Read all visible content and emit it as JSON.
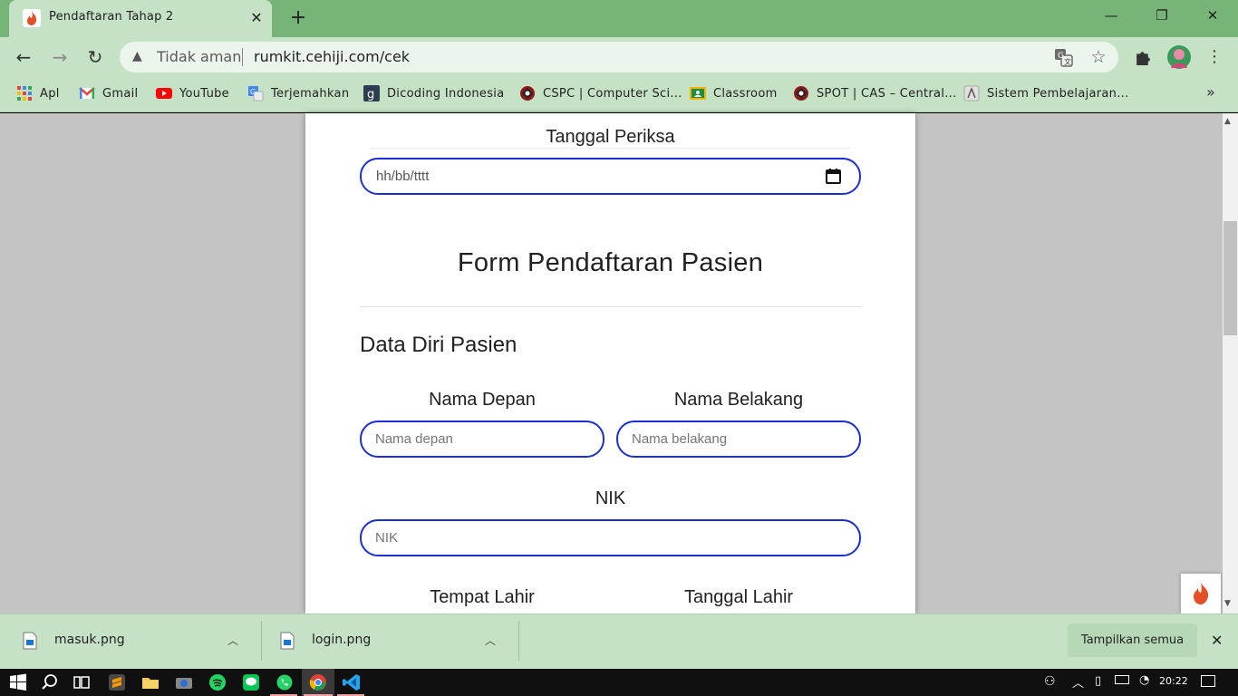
{
  "browser": {
    "tab": {
      "title": "Pendaftaran Tahap 2"
    },
    "omnibox": {
      "security_text": "Tidak aman",
      "url": "rumkit.cehiji.com/cek"
    },
    "bookmarks": [
      {
        "label": "Apl",
        "icon": "apps-grid-icon"
      },
      {
        "label": "Gmail",
        "icon": "gmail-icon"
      },
      {
        "label": "YouTube",
        "icon": "youtube-icon"
      },
      {
        "label": "Terjemahkan",
        "icon": "translate-icon"
      },
      {
        "label": "Dicoding Indonesia",
        "icon": "dicoding-icon"
      },
      {
        "label": "CSPC | Computer Sci...",
        "icon": "cspc-icon"
      },
      {
        "label": "Classroom",
        "icon": "classroom-icon"
      },
      {
        "label": "SPOT | CAS – Central...",
        "icon": "spot-icon"
      },
      {
        "label": "Sistem Pembelajaran...",
        "icon": "sistem-icon"
      }
    ],
    "bookmarks_overflow": "»"
  },
  "form": {
    "tanggal_periksa": {
      "label": "Tanggal Periksa",
      "placeholder": "hh/bb/tttt"
    },
    "title": "Form Pendaftaran Pasien",
    "section_title": "Data Diri Pasien",
    "nama_depan": {
      "label": "Nama Depan",
      "placeholder": "Nama depan"
    },
    "nama_belakang": {
      "label": "Nama Belakang",
      "placeholder": "Nama belakang"
    },
    "nik": {
      "label": "NIK",
      "placeholder": "NIK"
    },
    "tempat_lahir": {
      "label": "Tempat Lahir"
    },
    "tanggal_lahir": {
      "label": "Tanggal Lahir"
    }
  },
  "downloads": {
    "items": [
      {
        "name": "masuk.png"
      },
      {
        "name": "login.png"
      }
    ],
    "show_all": "Tampilkan semua"
  },
  "taskbar": {
    "time": "20:22"
  },
  "colors": {
    "accent_border": "#1a2fd8",
    "chrome_green": "#c6e2c6",
    "tabstrip_green": "#77b477"
  }
}
